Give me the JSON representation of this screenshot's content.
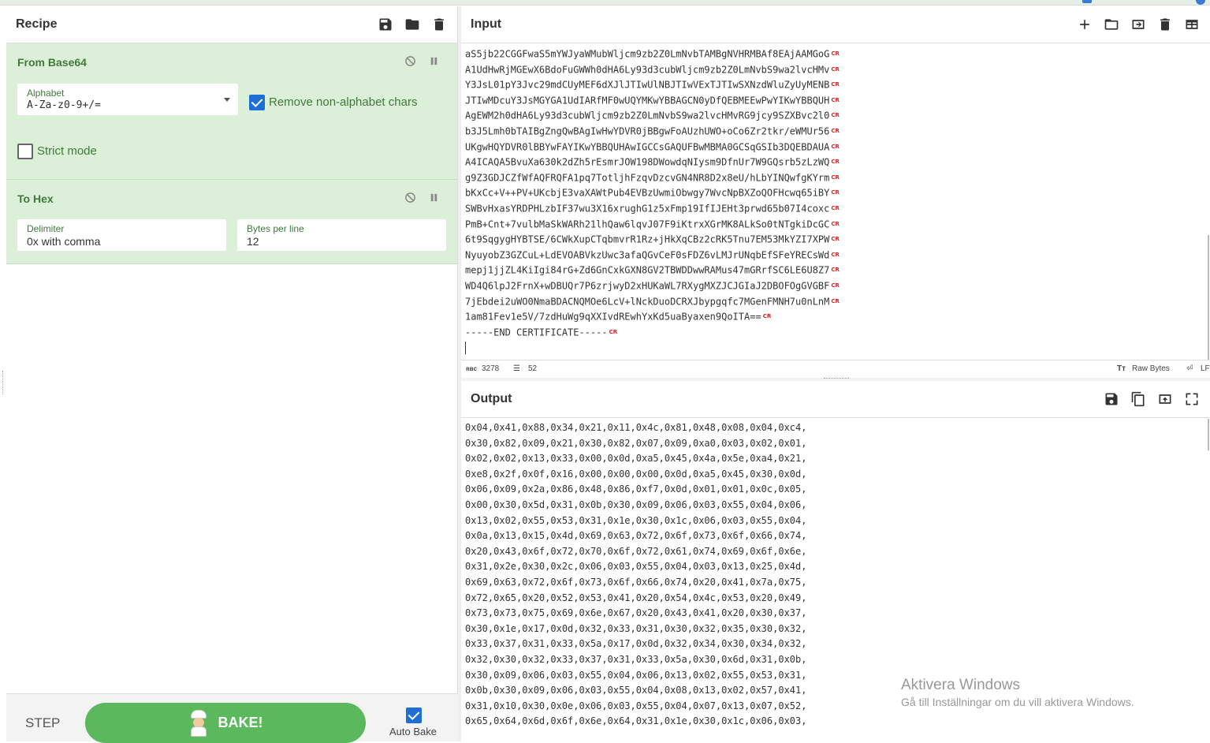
{
  "recipe": {
    "title": "Recipe",
    "operations": [
      {
        "name": "From Base64",
        "alphabet_label": "Alphabet",
        "alphabet_value": "A-Za-z0-9+/=",
        "remove_non_alpha_label": "Remove non-alphabet chars",
        "remove_non_alpha_checked": true,
        "strict_mode_label": "Strict mode",
        "strict_mode_checked": false
      },
      {
        "name": "To Hex",
        "delimiter_label": "Delimiter",
        "delimiter_value": "0x with comma",
        "bytes_label": "Bytes per line",
        "bytes_value": "12"
      }
    ],
    "step_label": "STEP",
    "bake_label": "BAKE!",
    "autobake_label": "Auto Bake",
    "autobake_checked": true
  },
  "input": {
    "title": "Input",
    "lines": [
      "aS5jb22CGGFwaS5mYWJyaWMubWljcm9zb2Z0LmNvbTAMBgNVHRMBAf8EAjAAMGoG",
      "A1UdHwRjMGEwX6BdoFuGWWh0dHA6Ly93d3cubWljcm9zb2Z0LmNvbS9wa2lvcHMv",
      "Y3JsL01pY3Jvc29mdCUyMEF6dXJlJTIwUlNBJTIwVExTJTIwSXNzdWluZyUyMENB",
      "JTIwMDcuY3JsMGYGA1UdIARfMF0wUQYMKwYBBAGCN0yDfQEBMEEwPwYIKwYBBQUH",
      "AgEWM2h0dHA6Ly93d3cubWljcm9zb2Z0LmNvbS9wa2lvcHMvRG9jcy9SZXBvc2l0",
      "b3J5Lmh0bTAIBgZngQwBAgIwHwYDVR0jBBgwFoAUzhUWO+oCo6Zr2tkr/eWMUr56",
      "UKgwHQYDVR0lBBYwFAYIKwYBBQUHAwIGCCsGAQUFBwMBMA0GCSqGSIb3DQEBDAUA",
      "A4ICAQA5BvuXa630k2dZh5rEsmrJOW198DWowdqNIysm9DfnUr7W9GQsrb5zLzWQ",
      "g9Z3GDJCZfWfAQFRQFA1pq7TotljhFzqvDzcvGN4NR8D2x8eU/hLbYINQwfgKYrm",
      "bKxCc+V++PV+UKcbjE3vaXAWtPub4EVBzUwmiObwgy7WvcNpBXZoQOFHcwq65iBY",
      "SWBvHxasYRDPHLzbIF37wu3X16xrughG1z5xFmp19IfIJEHt3prwd65b07I4coxc",
      "PmB+Cnt+7vulbMaSkWARh21lhQaw6lqvJ07F9iKtrxXGrMK8ALkSo0tNTgkiDcGC",
      "6t9SqgygHYBTSE/6CWkXupCTqbmvrR1Rz+jHkXqCBz2cRK5Tnu7EM53MkYZI7XPW",
      "NyuyobZ3GZCuL+LdEVOABVkzUwc3afaQGvCeF0sFDZ6vLMJrUNqbEfSFeYRECsWd",
      "mepj1jjZL4KiIgi84rG+Zd6GnCxkGXN8GV2TBWDDwwRAMus47mGRrfSC6LE6U8Z7",
      "WD4Q6lpJ2FrnX+wDBUQr7P6zrjwyD2xHUKaWL7RXygMXZJCJGIaJ2DBOFOgGVGBF",
      "7jEbdei2uWO0NmaBDACNQMOe6LcV+lNckDuoDCRXJbypgqfc7MGenFMNH7u0nLnM",
      "1am81Fev1e5V/7zdHuWg9qXXIvdREwhYxKd5uaByaxen9QoITA==",
      "-----END CERTIFICATE-----"
    ],
    "line_end_marker": "CR",
    "length_icon": "abc-icon",
    "length": "3278",
    "lines_count": "52",
    "format_label": "Raw Bytes",
    "eol_label": "LF"
  },
  "output": {
    "title": "Output",
    "lines": [
      "0x04,0x41,0x88,0x34,0x21,0x11,0x4c,0x81,0x48,0x08,0x04,0xc4,",
      "0x30,0x82,0x09,0x21,0x30,0x82,0x07,0x09,0xa0,0x03,0x02,0x01,",
      "0x02,0x02,0x13,0x33,0x00,0x0d,0xa5,0x45,0x4a,0x5e,0xa4,0x21,",
      "0xe8,0x2f,0x0f,0x16,0x00,0x00,0x00,0x0d,0xa5,0x45,0x30,0x0d,",
      "0x06,0x09,0x2a,0x86,0x48,0x86,0xf7,0x0d,0x01,0x01,0x0c,0x05,",
      "0x00,0x30,0x5d,0x31,0x0b,0x30,0x09,0x06,0x03,0x55,0x04,0x06,",
      "0x13,0x02,0x55,0x53,0x31,0x1e,0x30,0x1c,0x06,0x03,0x55,0x04,",
      "0x0a,0x13,0x15,0x4d,0x69,0x63,0x72,0x6f,0x73,0x6f,0x66,0x74,",
      "0x20,0x43,0x6f,0x72,0x70,0x6f,0x72,0x61,0x74,0x69,0x6f,0x6e,",
      "0x31,0x2e,0x30,0x2c,0x06,0x03,0x55,0x04,0x03,0x13,0x25,0x4d,",
      "0x69,0x63,0x72,0x6f,0x73,0x6f,0x66,0x74,0x20,0x41,0x7a,0x75,",
      "0x72,0x65,0x20,0x52,0x53,0x41,0x20,0x54,0x4c,0x53,0x20,0x49,",
      "0x73,0x73,0x75,0x69,0x6e,0x67,0x20,0x43,0x41,0x20,0x30,0x37,",
      "0x30,0x1e,0x17,0x0d,0x32,0x33,0x31,0x30,0x32,0x35,0x30,0x32,",
      "0x33,0x37,0x31,0x33,0x5a,0x17,0x0d,0x32,0x34,0x30,0x34,0x32,",
      "0x32,0x30,0x32,0x33,0x37,0x31,0x33,0x5a,0x30,0x6d,0x31,0x0b,",
      "0x30,0x09,0x06,0x03,0x55,0x04,0x06,0x13,0x02,0x55,0x53,0x31,",
      "0x0b,0x30,0x09,0x06,0x03,0x55,0x04,0x08,0x13,0x02,0x57,0x41,",
      "0x31,0x10,0x30,0x0e,0x06,0x03,0x55,0x04,0x07,0x13,0x07,0x52,",
      "0x65,0x64,0x6d,0x6f,0x6e,0x64,0x31,0x1e,0x30,0x1c,0x06,0x03,"
    ]
  },
  "watermark": {
    "line1": "Aktivera Windows",
    "line2": "Gå till Inställningar om du vill aktivera Windows."
  }
}
